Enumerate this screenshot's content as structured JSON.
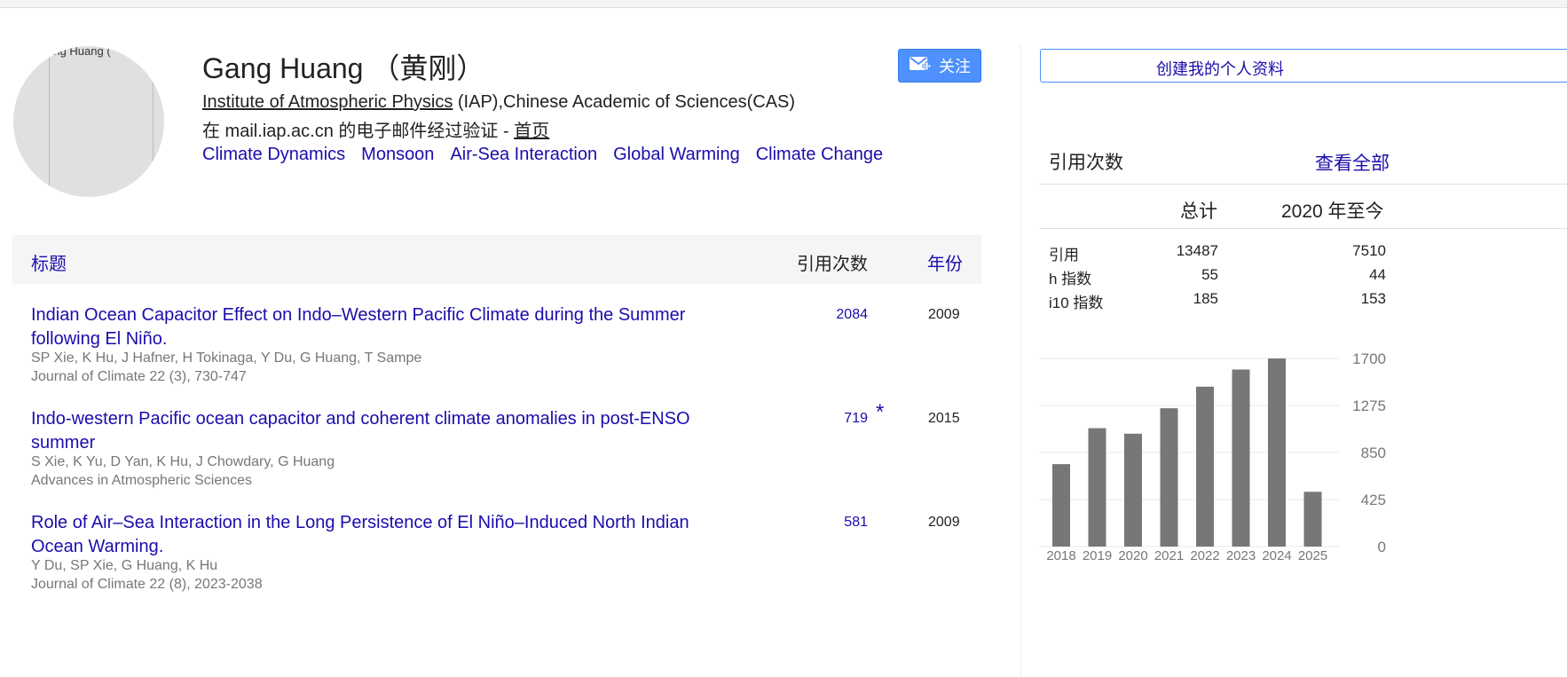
{
  "profile": {
    "name": "Gang Huang （黄刚）",
    "avatar_alt": "Gang Huang (",
    "affiliation_link": "Institute of Atmospheric Physics",
    "affiliation_rest": " (IAP),Chinese Academic of Sciences(CAS)",
    "email_text": "在 mail.iap.ac.cn 的电子邮件经过验证 - ",
    "homepage_label": "首页",
    "interests": [
      "Climate Dynamics",
      "Monsoon",
      "Air-Sea Interaction",
      "Global Warming",
      "Climate Change"
    ],
    "follow_label": "关注"
  },
  "table": {
    "col_title": "标题",
    "col_cited": "引用次数",
    "col_year": "年份",
    "rows": [
      {
        "title": "Indian Ocean Capacitor Effect on Indo–Western Pacific Climate during the Summer following El Niño.",
        "authors": "SP Xie, K Hu, J Hafner, H Tokinaga, Y Du, G Huang, T Sampe",
        "venue": "Journal of Climate 22 (3), 730-747",
        "cited": "2084",
        "year": "2009",
        "star": ""
      },
      {
        "title": "Indo-western Pacific ocean capacitor and coherent climate anomalies in post-ENSO summer",
        "authors": "S Xie, K Yu, D Yan, K Hu, J Chowdary, G Huang",
        "venue": "Advances in Atmospheric Sciences",
        "cited": "719",
        "year": "2015",
        "star": "*"
      },
      {
        "title": "Role of Air–Sea Interaction in the Long Persistence of El Niño–Induced North Indian Ocean Warming.",
        "authors": "Y Du, SP Xie, G Huang, K Hu",
        "venue": "Journal of Climate 22 (8), 2023-2038",
        "cited": "581",
        "year": "2009",
        "star": ""
      }
    ]
  },
  "sidebar": {
    "create_profile_label": "创建我的个人资料",
    "cited_by_title": "引用次数",
    "view_all_label": "查看全部",
    "col_all": "总计",
    "col_since": "2020 年至今",
    "stats": [
      {
        "label": "引用",
        "all": "13487",
        "since": "7510"
      },
      {
        "label": "h 指数",
        "all": "55",
        "since": "44"
      },
      {
        "label": "i10 指数",
        "all": "185",
        "since": "153"
      }
    ]
  },
  "chart_data": {
    "type": "bar",
    "categories": [
      "2018",
      "2019",
      "2020",
      "2021",
      "2022",
      "2023",
      "2024",
      "2025"
    ],
    "values": [
      745,
      1070,
      1020,
      1250,
      1445,
      1600,
      1700,
      495
    ],
    "yticks": [
      0,
      425,
      850,
      1275,
      1700
    ],
    "ylim": [
      0,
      1700
    ],
    "bar_color": "#777777"
  }
}
